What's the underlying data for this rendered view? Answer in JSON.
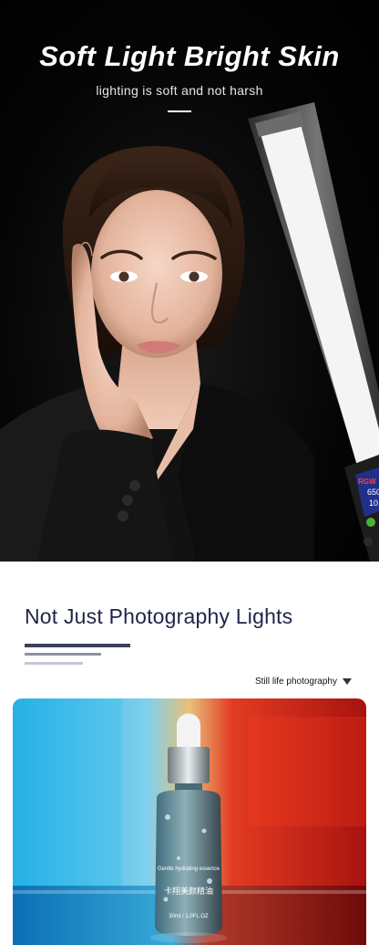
{
  "hero": {
    "title": "Soft Light Bright Skin",
    "subtitle": "lighting is soft and not harsh"
  },
  "device_screen": {
    "line1": "RGW",
    "line2": "650",
    "line3": "10"
  },
  "section": {
    "title": "Not Just Photography Lights",
    "tag": "Still life photography"
  },
  "product_label": {
    "line1": "Gentle hydrating essence",
    "line2": "卡翔美颜精油",
    "line3": "30ml / 1.0FL.OZ"
  },
  "colors": {
    "title_navy": "#1f2547",
    "light_blue": "#22b6e6",
    "light_red": "#d81a14"
  }
}
